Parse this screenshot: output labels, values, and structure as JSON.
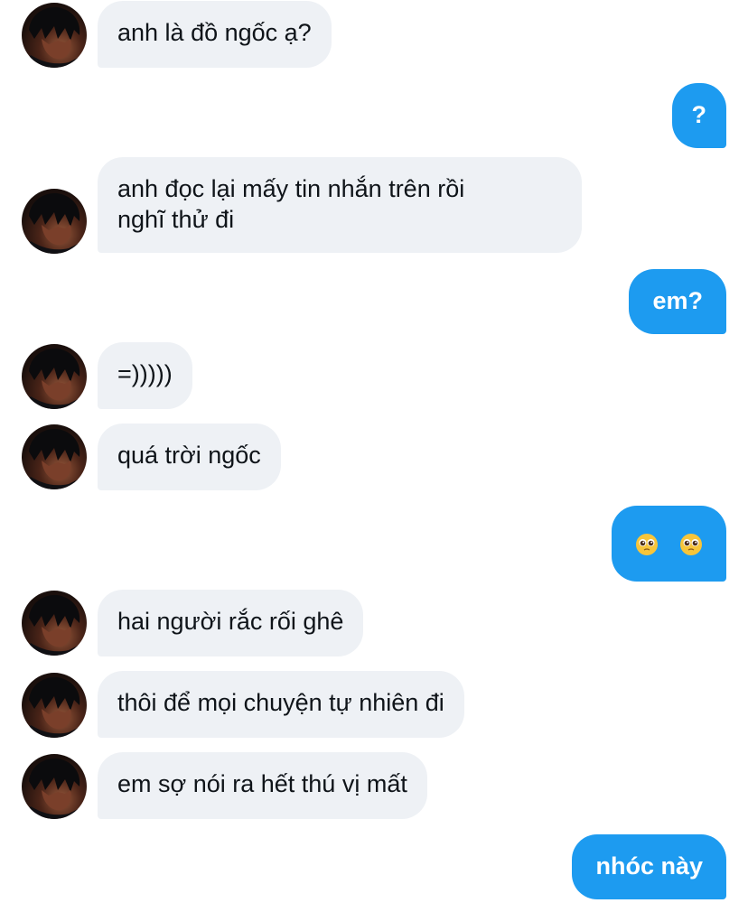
{
  "messages": [
    {
      "from": "them",
      "text": "anh là đồ ngốc ạ?"
    },
    {
      "from": "me",
      "text": "?"
    },
    {
      "from": "them",
      "text": "anh đọc lại mấy tin nhắn trên rồi",
      "text2": "nghĩ thử đi"
    },
    {
      "from": "me",
      "text": "em?"
    },
    {
      "from": "them",
      "text": "=)))))"
    },
    {
      "from": "them",
      "text": "quá trời ngốc"
    },
    {
      "from": "me",
      "text": "🥺 🥺",
      "emoji": "pleading-face-emoji"
    },
    {
      "from": "them",
      "text": "hai người rắc rối ghê"
    },
    {
      "from": "them",
      "text": "thôi để mọi chuyện tự nhiên đi"
    },
    {
      "from": "them",
      "text": "em sợ nói ra hết thú vị mất"
    },
    {
      "from": "me",
      "text": "nhóc này"
    }
  ],
  "avatar_icon": "profile-avatar",
  "colors": {
    "incoming_bubble": "#eef1f5",
    "outgoing_bubble": "#1d9bf0",
    "outgoing_text": "#ffffff",
    "incoming_text": "#0f1419"
  }
}
